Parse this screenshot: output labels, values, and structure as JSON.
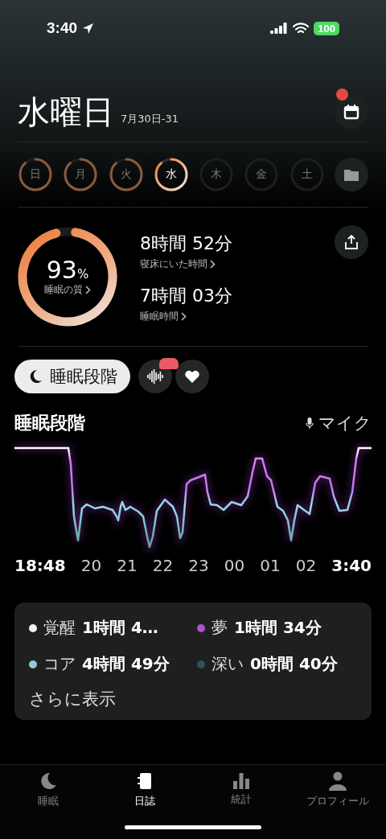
{
  "status_bar": {
    "time": "3:40",
    "battery": "100"
  },
  "header": {
    "title": "水曜日",
    "date_range": "7月30日-31",
    "notification": true
  },
  "days": [
    {
      "label": "日",
      "has_data": true,
      "selected": false
    },
    {
      "label": "月",
      "has_data": true,
      "selected": false
    },
    {
      "label": "火",
      "has_data": true,
      "selected": false
    },
    {
      "label": "水",
      "has_data": true,
      "selected": true
    },
    {
      "label": "木",
      "has_data": false,
      "selected": false
    },
    {
      "label": "金",
      "has_data": false,
      "selected": false
    },
    {
      "label": "土",
      "has_data": false,
      "selected": false
    }
  ],
  "summary": {
    "quality": {
      "value": "93",
      "unit": "%",
      "label": "睡眠の質",
      "level": 0.93
    },
    "stats": [
      {
        "value": "8時間 52分",
        "label": "寝床にいた時間"
      },
      {
        "value": "7時間 03分",
        "label": "睡眠時間"
      }
    ]
  },
  "views": [
    {
      "kind": "stages",
      "label": "睡眠段階",
      "selected": true,
      "badge": false
    },
    {
      "kind": "sound",
      "selected": false,
      "badge": true
    },
    {
      "kind": "heart",
      "selected": false,
      "badge": false
    }
  ],
  "chart": {
    "title": "睡眠段階",
    "source": "マイク",
    "x_labels": [
      "18:48",
      "20",
      "21",
      "22",
      "23",
      "00",
      "01",
      "02",
      "3:40"
    ]
  },
  "legend": [
    {
      "name": "覚醒",
      "value": "1時間 4…",
      "color": "#f2f2f2"
    },
    {
      "name": "夢",
      "value": "1時間 34分",
      "color": "#b04fd6"
    },
    {
      "name": "コア",
      "value": "4時間 49分",
      "color": "#8ccbd8"
    },
    {
      "name": "深い",
      "value": "0時間 40分",
      "color": "#2d5258"
    }
  ],
  "more": "さらに表示",
  "tab_bar": [
    {
      "kind": "moon",
      "label": "睡眠",
      "selected": false
    },
    {
      "kind": "journal",
      "label": "日誌",
      "selected": true
    },
    {
      "kind": "stats",
      "label": "統計",
      "selected": false
    },
    {
      "kind": "person",
      "label": "プロフィール",
      "selected": false
    }
  ]
}
